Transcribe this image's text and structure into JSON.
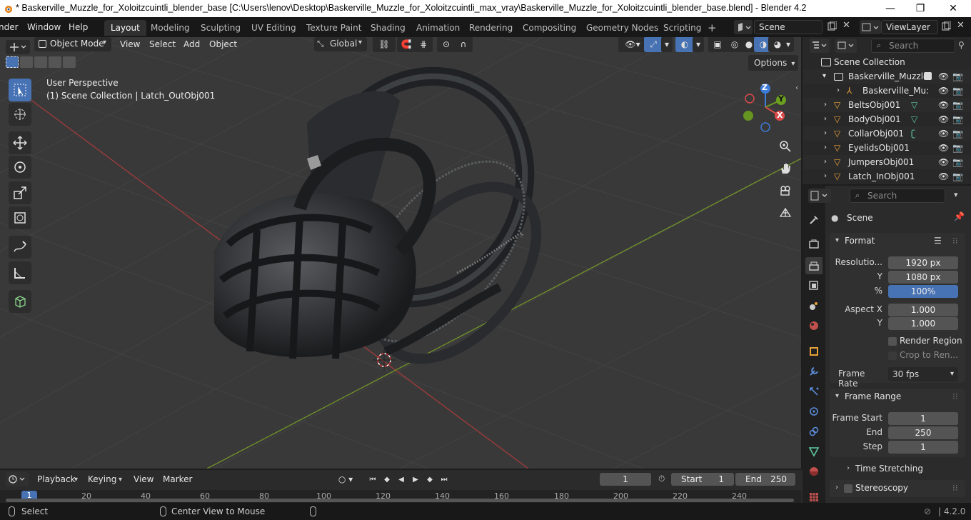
{
  "titlebar": {
    "title": "* Baskerville_Muzzle_for_Xoloitzcuintli_blender_base [C:\\Users\\lenov\\Desktop\\Baskerville_Muzzle_for_Xoloitzcuintli_max_vray\\Baskerville_Muzzle_for_Xoloitzcuintli_blender_base.blend] - Blender 4.2",
    "minimize": "—",
    "maximize": "❐",
    "close": "✕"
  },
  "menubar": {
    "items": [
      "nder",
      "Window",
      "Help"
    ]
  },
  "workspaces": [
    "Layout",
    "Modeling",
    "Sculpting",
    "UV Editing",
    "Texture Paint",
    "Shading",
    "Animation",
    "Rendering",
    "Compositing",
    "Geometry Nodes",
    "Scripting"
  ],
  "workspace_add": "+",
  "scene": {
    "name": "Scene"
  },
  "viewlayer": {
    "name": "ViewLayer"
  },
  "viewport_header": {
    "mode": "Object Mode",
    "menus": [
      "View",
      "Select",
      "Add",
      "Object"
    ],
    "transform_orientation": "Global",
    "options": "Options"
  },
  "viewport": {
    "perspective": "User Perspective",
    "collection_info": "(1) Scene Collection | Latch_OutObj001",
    "gizmo": {
      "z": "Z",
      "y": "Y",
      "x": "X"
    }
  },
  "outliner": {
    "search_placeholder": "Search",
    "root": "Scene Collection",
    "collection": "Baskerville_Muzzle",
    "items": [
      {
        "name": "Baskerville_Mu:",
        "type": "armature"
      },
      {
        "name": "BeltsObj001",
        "type": "mesh"
      },
      {
        "name": "BodyObj001",
        "type": "mesh"
      },
      {
        "name": "CollarObj001",
        "type": "mesh"
      },
      {
        "name": "EyelidsObj001",
        "type": "mesh"
      },
      {
        "name": "JumpersObj001",
        "type": "mesh"
      },
      {
        "name": "Latch_InObj001",
        "type": "mesh"
      }
    ]
  },
  "properties": {
    "search_placeholder": "Search",
    "context": "Scene",
    "format": {
      "header": "Format",
      "resolution_label": "Resolutio...",
      "resolution_x": "1920 px",
      "y_label": "Y",
      "resolution_y": "1080 px",
      "percent_label": "%",
      "percent": "100%",
      "aspect_x_label": "Aspect X",
      "aspect_x": "1.000",
      "aspect_y_label": "Y",
      "aspect_y": "1.000",
      "render_region": "Render Region",
      "crop": "Crop to Ren...",
      "frame_rate_label": "Frame Rate",
      "frame_rate": "30 fps"
    },
    "frame_range": {
      "header": "Frame Range",
      "start_label": "Frame Start",
      "start": "1",
      "end_label": "End",
      "end": "250",
      "step_label": "Step",
      "step": "1"
    },
    "time_stretching": "Time Stretching",
    "stereoscopy": "Stereoscopy"
  },
  "timeline": {
    "menus": [
      "Playback",
      "Keying",
      "View",
      "Marker"
    ],
    "current_frame": "1",
    "start_label": "Start",
    "start": "1",
    "end_label": "End",
    "end": "250",
    "ruler": [
      "1",
      "20",
      "40",
      "60",
      "80",
      "100",
      "120",
      "140",
      "160",
      "180",
      "200",
      "220",
      "240"
    ]
  },
  "statusbar": {
    "select": "Select",
    "center_view": "Center View to Mouse",
    "version": "4.2.0"
  },
  "colors": {
    "accent": "#4772b3",
    "grid_x": "#8b3a3a",
    "grid_y": "#6b8e23",
    "viewport_bg": "#393939"
  }
}
